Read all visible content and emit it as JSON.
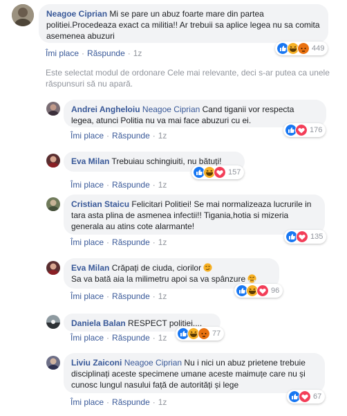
{
  "colors": {
    "link": "#385898",
    "meta": "#90949c",
    "bubble": "#f2f3f5",
    "like_blue": "#1877f2",
    "love_red": "#f33e58",
    "haha_yellow": "#f7b125",
    "angry_orange": "#e9710f"
  },
  "main_comment": {
    "author": "Neagoe Ciprian",
    "text": "Mi se pare un abuz foarte mare din partea politiei.Procedeaza exact ca militia!! Ar trebuii sa aplice legea nu sa comita asemenea abuzuri",
    "like_label": "Îmi place",
    "reply_label": "Răspunde",
    "time": "1z",
    "reactions": [
      "like",
      "haha",
      "angry"
    ],
    "reaction_count": "449"
  },
  "sort_notice": "Este selectat modul de ordonare Cele mai relevante, deci s-ar putea ca unele răspunsuri să nu apară.",
  "replies": [
    {
      "author": "Andrei Angheloiu",
      "mention": "Neagoe Ciprian",
      "text": "Cand tiganii vor respecta legea, atunci Politia nu va mai face abuzuri cu ei.",
      "like_label": "Îmi place",
      "reply_label": "Răspunde",
      "time": "1z",
      "reactions": [
        "like",
        "love"
      ],
      "reaction_count": "176"
    },
    {
      "author": "Eva Milan",
      "mention": "",
      "text": "Trebuiau schingiuiti, nu bătuți!",
      "like_label": "Îmi place",
      "reply_label": "Răspunde",
      "time": "1z",
      "reactions": [
        "like",
        "haha",
        "love"
      ],
      "reaction_count": "157"
    },
    {
      "author": "Cristian Staicu",
      "mention": "",
      "text": "Felicitari Politiei! Se mai normalizeaza lucrurile in tara asta plina de asmenea infectii!! Tigania,hotia si mizeria generala au atins cote alarmante!",
      "like_label": "Îmi place",
      "reply_label": "Răspunde",
      "time": "1z",
      "reactions": [
        "like",
        "love"
      ],
      "reaction_count": "135"
    },
    {
      "author": "Eva Milan",
      "mention": "",
      "text": "Crăpați de ciuda, ciorilor",
      "text2": "Sa va bată aia la milimetru apoi sa va spânzure",
      "like_label": "Îmi place",
      "reply_label": "Răspunde",
      "time": "1z",
      "reactions": [
        "like",
        "haha",
        "love"
      ],
      "reaction_count": "96"
    },
    {
      "author": "Daniela Balan",
      "mention": "",
      "text": "RESPECT politiei....",
      "like_label": "Îmi place",
      "reply_label": "Răspunde",
      "time": "1z",
      "reactions": [
        "like",
        "haha",
        "angry"
      ],
      "reaction_count": "77"
    },
    {
      "author": "Liviu Zaiconi",
      "mention": "Neagoe Ciprian",
      "text": "Nu i nici un abuz prietene trebuie disciplinați aceste specimene umane aceste maimuțe care nu și cunosc lungul nasului față de autorități și lege",
      "like_label": "Îmi place",
      "reply_label": "Răspunde",
      "time": "1z",
      "reactions": [
        "like",
        "love"
      ],
      "reaction_count": "67"
    }
  ]
}
